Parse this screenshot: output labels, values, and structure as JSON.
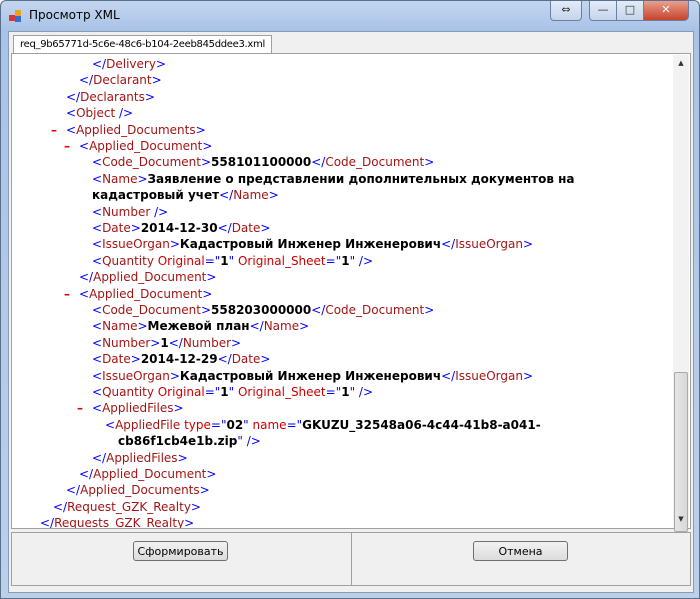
{
  "window": {
    "title": "Просмотр XML",
    "controls": {
      "minimize": "—",
      "maximize": "□",
      "close": "✕",
      "resize": "⇔"
    }
  },
  "tab": {
    "label": "req_9b65771d-5c6e-48c6-b104-2eeb845ddee3.xml"
  },
  "buttons": {
    "generate": "Сформировать",
    "cancel": "Отмена"
  },
  "xml_lines": [
    {
      "indent": 4,
      "tokens": [
        [
          "b",
          "</"
        ],
        [
          "t",
          "Delivery"
        ],
        [
          "b",
          ">"
        ]
      ]
    },
    {
      "indent": 3,
      "tokens": [
        [
          "b",
          "</"
        ],
        [
          "t",
          "Declarant"
        ],
        [
          "b",
          ">"
        ]
      ]
    },
    {
      "indent": 2,
      "tokens": [
        [
          "b",
          "</"
        ],
        [
          "t",
          "Declarants"
        ],
        [
          "b",
          ">"
        ]
      ]
    },
    {
      "indent": 2,
      "tokens": [
        [
          "b",
          "<"
        ],
        [
          "t",
          "Object"
        ],
        [
          "b",
          " />"
        ]
      ]
    },
    {
      "indent": 2,
      "marker": "–",
      "tokens": [
        [
          "b",
          "<"
        ],
        [
          "t",
          "Applied_Documents"
        ],
        [
          "b",
          ">"
        ]
      ]
    },
    {
      "indent": 3,
      "marker": "–",
      "tokens": [
        [
          "b",
          "<"
        ],
        [
          "t",
          "Applied_Document"
        ],
        [
          "b",
          ">"
        ]
      ]
    },
    {
      "indent": 4,
      "tokens": [
        [
          "b",
          "<"
        ],
        [
          "t",
          "Code_Document"
        ],
        [
          "b",
          ">"
        ],
        [
          "v",
          "558101100000"
        ],
        [
          "b",
          "</"
        ],
        [
          "t",
          "Code_Document"
        ],
        [
          "b",
          ">"
        ]
      ]
    },
    {
      "indent": 4,
      "tokens": [
        [
          "b",
          "<"
        ],
        [
          "t",
          "Name"
        ],
        [
          "b",
          ">"
        ],
        [
          "v",
          "Заявление о представлении дополнительных документов на"
        ]
      ]
    },
    {
      "indent": 4,
      "tokens": [
        [
          "v",
          "кадастровый учет"
        ],
        [
          "b",
          "</"
        ],
        [
          "t",
          "Name"
        ],
        [
          "b",
          ">"
        ]
      ]
    },
    {
      "indent": 4,
      "tokens": [
        [
          "b",
          "<"
        ],
        [
          "t",
          "Number"
        ],
        [
          "b",
          " />"
        ]
      ]
    },
    {
      "indent": 4,
      "tokens": [
        [
          "b",
          "<"
        ],
        [
          "t",
          "Date"
        ],
        [
          "b",
          ">"
        ],
        [
          "v",
          "2014-12-30"
        ],
        [
          "b",
          "</"
        ],
        [
          "t",
          "Date"
        ],
        [
          "b",
          ">"
        ]
      ]
    },
    {
      "indent": 4,
      "tokens": [
        [
          "b",
          "<"
        ],
        [
          "t",
          "IssueOrgan"
        ],
        [
          "b",
          ">"
        ],
        [
          "v",
          "Кадастровый Инженер Инженерович"
        ],
        [
          "b",
          "</"
        ],
        [
          "t",
          "IssueOrgan"
        ],
        [
          "b",
          ">"
        ]
      ]
    },
    {
      "indent": 4,
      "tokens": [
        [
          "b",
          "<"
        ],
        [
          "t",
          "Quantity"
        ],
        [
          "a",
          " Original"
        ],
        [
          "b",
          "=\""
        ],
        [
          "v",
          "1"
        ],
        [
          "b",
          "\""
        ],
        [
          "a",
          " Original_Sheet"
        ],
        [
          "b",
          "=\""
        ],
        [
          "v",
          "1"
        ],
        [
          "b",
          "\" />"
        ]
      ]
    },
    {
      "indent": 3,
      "tokens": [
        [
          "b",
          "</"
        ],
        [
          "t",
          "Applied_Document"
        ],
        [
          "b",
          ">"
        ]
      ]
    },
    {
      "indent": 3,
      "marker": "–",
      "tokens": [
        [
          "b",
          "<"
        ],
        [
          "t",
          "Applied_Document"
        ],
        [
          "b",
          ">"
        ]
      ]
    },
    {
      "indent": 4,
      "tokens": [
        [
          "b",
          "<"
        ],
        [
          "t",
          "Code_Document"
        ],
        [
          "b",
          ">"
        ],
        [
          "v",
          "558203000000"
        ],
        [
          "b",
          "</"
        ],
        [
          "t",
          "Code_Document"
        ],
        [
          "b",
          ">"
        ]
      ]
    },
    {
      "indent": 4,
      "tokens": [
        [
          "b",
          "<"
        ],
        [
          "t",
          "Name"
        ],
        [
          "b",
          ">"
        ],
        [
          "v",
          "Межевой план"
        ],
        [
          "b",
          "</"
        ],
        [
          "t",
          "Name"
        ],
        [
          "b",
          ">"
        ]
      ]
    },
    {
      "indent": 4,
      "tokens": [
        [
          "b",
          "<"
        ],
        [
          "t",
          "Number"
        ],
        [
          "b",
          ">"
        ],
        [
          "v",
          "1"
        ],
        [
          "b",
          "</"
        ],
        [
          "t",
          "Number"
        ],
        [
          "b",
          ">"
        ]
      ]
    },
    {
      "indent": 4,
      "tokens": [
        [
          "b",
          "<"
        ],
        [
          "t",
          "Date"
        ],
        [
          "b",
          ">"
        ],
        [
          "v",
          "2014-12-29"
        ],
        [
          "b",
          "</"
        ],
        [
          "t",
          "Date"
        ],
        [
          "b",
          ">"
        ]
      ]
    },
    {
      "indent": 4,
      "tokens": [
        [
          "b",
          "<"
        ],
        [
          "t",
          "IssueOrgan"
        ],
        [
          "b",
          ">"
        ],
        [
          "v",
          "Кадастровый Инженер Инженерович"
        ],
        [
          "b",
          "</"
        ],
        [
          "t",
          "IssueOrgan"
        ],
        [
          "b",
          ">"
        ]
      ]
    },
    {
      "indent": 4,
      "tokens": [
        [
          "b",
          "<"
        ],
        [
          "t",
          "Quantity"
        ],
        [
          "a",
          " Original"
        ],
        [
          "b",
          "=\""
        ],
        [
          "v",
          "1"
        ],
        [
          "b",
          "\""
        ],
        [
          "a",
          " Original_Sheet"
        ],
        [
          "b",
          "=\""
        ],
        [
          "v",
          "1"
        ],
        [
          "b",
          "\" />"
        ]
      ]
    },
    {
      "indent": 4,
      "marker": "–",
      "tokens": [
        [
          "b",
          "<"
        ],
        [
          "t",
          "AppliedFiles"
        ],
        [
          "b",
          ">"
        ]
      ]
    },
    {
      "indent": 5,
      "tokens": [
        [
          "b",
          "<"
        ],
        [
          "t",
          "AppliedFile"
        ],
        [
          "a",
          " type"
        ],
        [
          "b",
          "=\""
        ],
        [
          "v",
          "02"
        ],
        [
          "b",
          "\""
        ],
        [
          "a",
          " name"
        ],
        [
          "b",
          "=\""
        ],
        [
          "v",
          "GKUZU_32548a06-4c44-41b8-a041-"
        ]
      ]
    },
    {
      "indent": 6,
      "tokens": [
        [
          "v",
          "cb86f1cb4e1b.zip"
        ],
        [
          "b",
          "\" />"
        ]
      ]
    },
    {
      "indent": 4,
      "tokens": [
        [
          "b",
          "</"
        ],
        [
          "t",
          "AppliedFiles"
        ],
        [
          "b",
          ">"
        ]
      ]
    },
    {
      "indent": 3,
      "tokens": [
        [
          "b",
          "</"
        ],
        [
          "t",
          "Applied_Document"
        ],
        [
          "b",
          ">"
        ]
      ]
    },
    {
      "indent": 2,
      "tokens": [
        [
          "b",
          "</"
        ],
        [
          "t",
          "Applied_Documents"
        ],
        [
          "b",
          ">"
        ]
      ]
    },
    {
      "indent": 1,
      "tokens": [
        [
          "b",
          "</"
        ],
        [
          "t",
          "Request_GZK_Realty"
        ],
        [
          "b",
          ">"
        ]
      ]
    },
    {
      "indent": 0,
      "tokens": [
        [
          "b",
          "</"
        ],
        [
          "t",
          "Requests_GZK_Realty"
        ],
        [
          "b",
          ">"
        ]
      ]
    }
  ]
}
